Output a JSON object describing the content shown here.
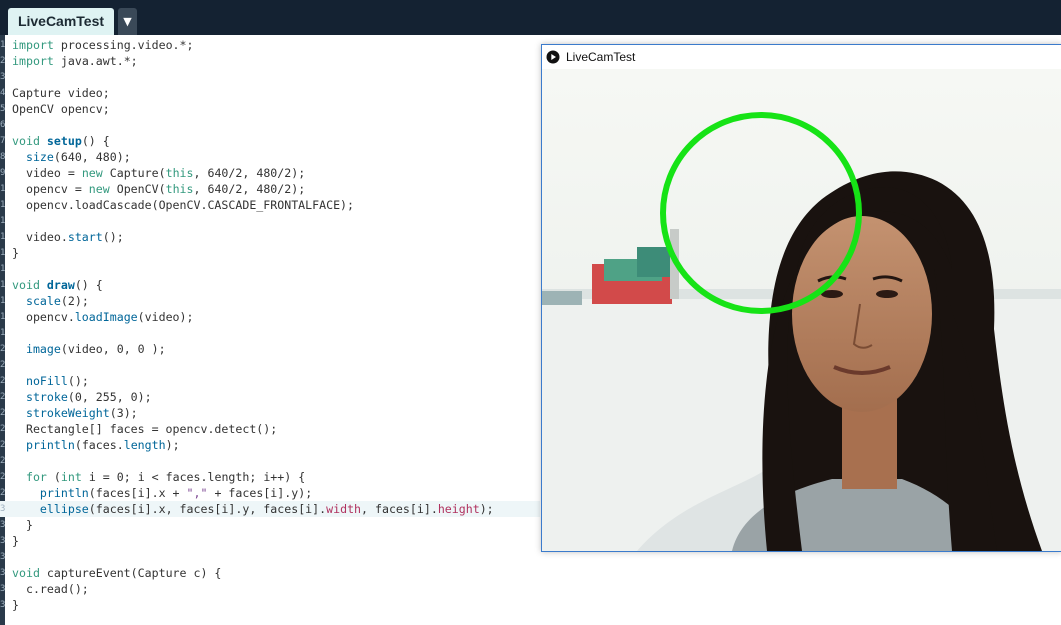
{
  "tab": {
    "label": "LiveCamTest",
    "menu_glyph": "▼"
  },
  "editor": {
    "active_line": 29,
    "lines": [
      [
        [
          "kw",
          "import"
        ],
        [
          "",
          "processing.video.*;"
        ]
      ],
      [
        [
          "kw",
          "import"
        ],
        [
          "",
          "java.awt.*;"
        ]
      ],
      [],
      [
        [
          "",
          "Capture video;"
        ]
      ],
      [
        [
          "",
          "OpenCV opencv;"
        ]
      ],
      [],
      [
        [
          "kw",
          "void"
        ],
        [
          "",
          ""
        ],
        [
          "bfn",
          "setup"
        ],
        [
          "",
          "() {"
        ]
      ],
      [
        [
          "",
          "  "
        ],
        [
          "fn",
          "size"
        ],
        [
          "",
          "(640, 480);"
        ]
      ],
      [
        [
          "",
          "  video = "
        ],
        [
          "kw",
          "new"
        ],
        [
          "",
          ""
        ],
        [
          "",
          "Capture("
        ],
        [
          "kw",
          "this"
        ],
        [
          "",
          ", 640/2, 480/2);"
        ]
      ],
      [
        [
          "",
          "  opencv = "
        ],
        [
          "kw",
          "new"
        ],
        [
          "",
          ""
        ],
        [
          "",
          "OpenCV("
        ],
        [
          "kw",
          "this"
        ],
        [
          "",
          ", 640/2, 480/2);"
        ]
      ],
      [
        [
          "",
          "  opencv.loadCascade(OpenCV.CASCADE_FRONTALFACE);"
        ]
      ],
      [],
      [
        [
          "",
          "  video."
        ],
        [
          "fn",
          "start"
        ],
        [
          "",
          "();"
        ]
      ],
      [
        [
          "",
          "}"
        ]
      ],
      [],
      [
        [
          "kw",
          "void"
        ],
        [
          "",
          ""
        ],
        [
          "bfn",
          "draw"
        ],
        [
          "",
          "() {"
        ]
      ],
      [
        [
          "",
          "  "
        ],
        [
          "fn",
          "scale"
        ],
        [
          "",
          "(2);"
        ]
      ],
      [
        [
          "",
          "  opencv."
        ],
        [
          "fn",
          "loadImage"
        ],
        [
          "",
          "(video);"
        ]
      ],
      [],
      [
        [
          "",
          "  "
        ],
        [
          "fn",
          "image"
        ],
        [
          "",
          "(video, 0, 0 );"
        ]
      ],
      [],
      [
        [
          "",
          "  "
        ],
        [
          "fn",
          "noFill"
        ],
        [
          "",
          "();"
        ]
      ],
      [
        [
          "",
          "  "
        ],
        [
          "fn",
          "stroke"
        ],
        [
          "",
          "(0, 255, 0);"
        ]
      ],
      [
        [
          "",
          "  "
        ],
        [
          "fn",
          "strokeWeight"
        ],
        [
          "",
          "(3);"
        ]
      ],
      [
        [
          "",
          "  Rectangle[] faces = opencv.detect();"
        ]
      ],
      [
        [
          "",
          "  "
        ],
        [
          "fn",
          "println"
        ],
        [
          "",
          "(faces."
        ],
        [
          "fn",
          "length"
        ],
        [
          "",
          ");"
        ]
      ],
      [],
      [
        [
          "",
          "  "
        ],
        [
          "kw",
          "for"
        ],
        [
          "",
          ""
        ],
        [
          "",
          "("
        ],
        [
          "kw",
          "int"
        ],
        [
          "",
          ""
        ],
        [
          "",
          "i = 0; i < faces.length; i++) {"
        ]
      ],
      [
        [
          "",
          "    "
        ],
        [
          "fn",
          "println"
        ],
        [
          "",
          "(faces[i].x + "
        ],
        [
          "str",
          "\",\""
        ],
        [
          "",
          ""
        ],
        [
          "",
          "+ faces[i].y);"
        ]
      ],
      [
        [
          "",
          "    "
        ],
        [
          "fn",
          "ellipse"
        ],
        [
          "",
          "(faces[i].x, faces[i].y, faces[i]."
        ],
        [
          "fld",
          "width"
        ],
        [
          "",
          ", faces[i]."
        ],
        [
          "fld",
          "height"
        ],
        [
          "",
          ");"
        ]
      ],
      [
        [
          "",
          "  }"
        ]
      ],
      [
        [
          "",
          "}"
        ]
      ],
      [],
      [
        [
          "kw",
          "void"
        ],
        [
          "",
          ""
        ],
        [
          "",
          "captureEvent(Capture c) {"
        ]
      ],
      [
        [
          "",
          "  c.read();"
        ]
      ],
      [
        [
          "",
          "}"
        ]
      ]
    ]
  },
  "sketch_window": {
    "title": "LiveCamTest",
    "detection_ring_color": "#16e316"
  }
}
